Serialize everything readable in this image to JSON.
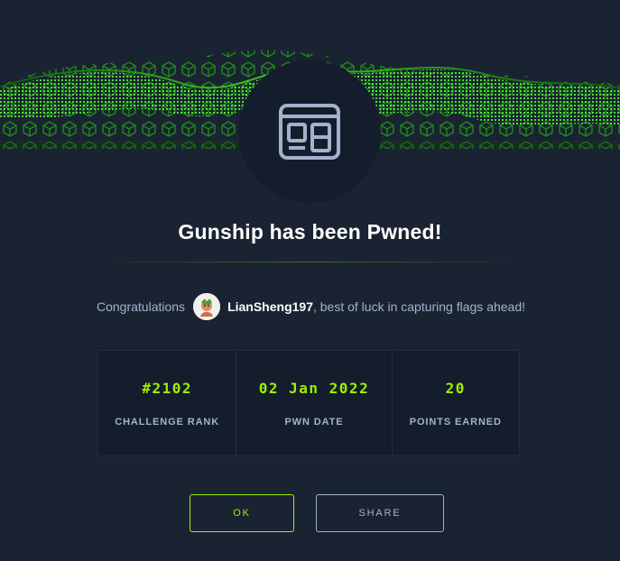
{
  "modal": {
    "title": "Gunship has been Pwned!",
    "congrats_prefix": "Congratulations",
    "username": "LianSheng197",
    "congrats_suffix": ", best of luck in capturing flags ahead!"
  },
  "stats": [
    {
      "value": "#2102",
      "label": "CHALLENGE RANK"
    },
    {
      "value": "02 Jan 2022",
      "label": "PWN DATE"
    },
    {
      "value": "20",
      "label": "POINTS EARNED"
    }
  ],
  "buttons": {
    "ok_label": "OK",
    "share_label": "SHARE"
  },
  "colors": {
    "background": "#1a2332",
    "panel": "#141d2b",
    "accent": "#9fef00",
    "muted_text": "#a4b1cd"
  },
  "icons": {
    "badge": "web-category-icon",
    "avatar": "user-avatar"
  }
}
